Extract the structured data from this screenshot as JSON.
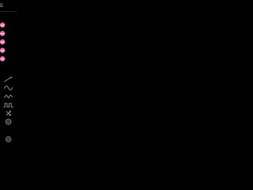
{
  "toolbar": {
    "menu_icon": "hamburger-icon",
    "accent_color": "#ff3d7a",
    "swatches": [
      {
        "name": "swatch-1",
        "color": "#ff8fc2",
        "top_color": "#ff5fa8"
      },
      {
        "name": "swatch-2",
        "color": "#ff8fc2",
        "top_color": "#ff5fa8"
      },
      {
        "name": "swatch-3",
        "color": "#ff8fc2",
        "top_color": "#ff5fa8"
      },
      {
        "name": "swatch-4",
        "color": "#ff8fc2",
        "top_color": "#ff5fa8"
      },
      {
        "name": "swatch-5",
        "color": "#ff8fc2",
        "top_color": "#ff5fa8"
      }
    ],
    "tools": [
      {
        "icon": "ramp-wave-icon"
      },
      {
        "icon": "sine-wave-icon"
      },
      {
        "icon": "triangle-wave-icon"
      },
      {
        "icon": "square-wave-icon"
      },
      {
        "icon": "shuffle-icon"
      },
      {
        "icon": "hexagon-gear-icon"
      },
      {
        "icon": "settings-gear-icon"
      }
    ],
    "icon_color": "#9a9a9a"
  }
}
